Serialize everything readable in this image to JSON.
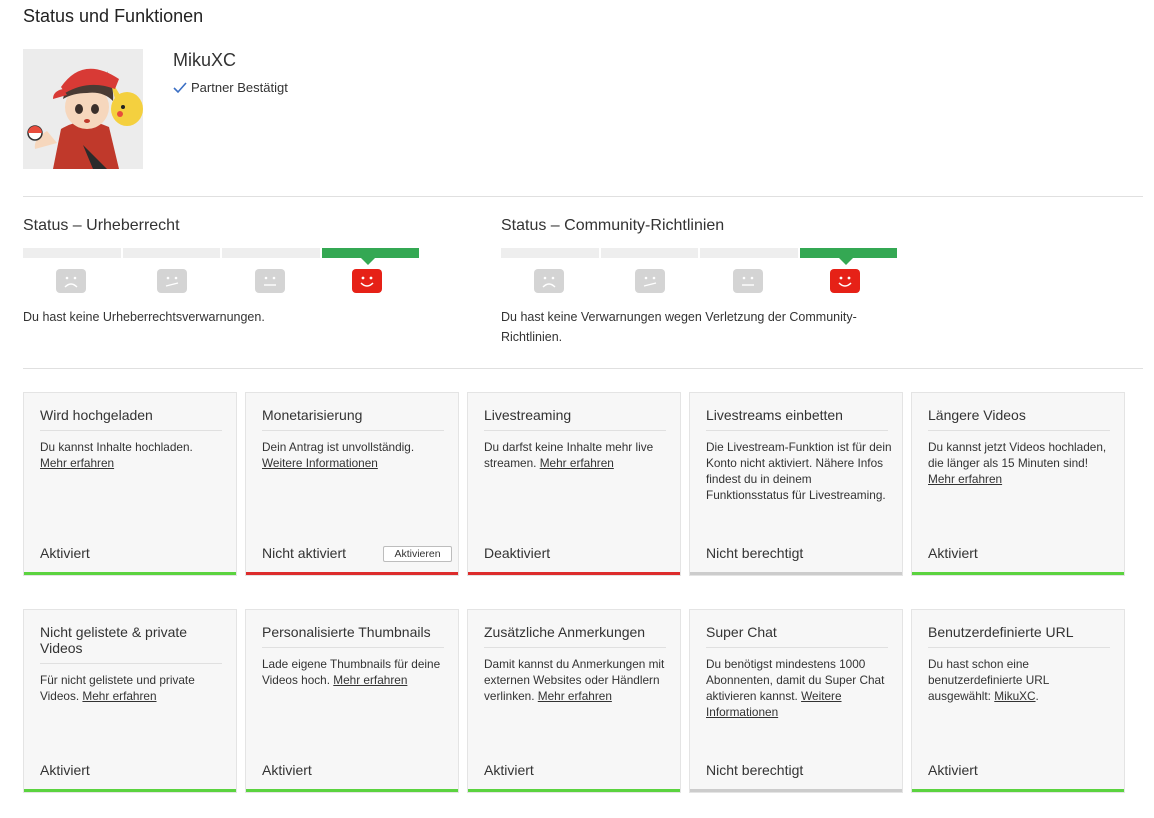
{
  "page": {
    "title": "Status und Funktionen"
  },
  "channel": {
    "name": "MikuXC",
    "partner_label": "Partner Bestätigt"
  },
  "copyright": {
    "title": "Status – Urheberrecht",
    "text": "Du hast keine Urheberrechtsverwarnungen."
  },
  "community": {
    "title": "Status – Community-Richtlinien",
    "text": "Du hast keine Verwarnungen wegen Verletzung der Community-Richtlinien."
  },
  "colors": {
    "enabled": "#5bd33f",
    "disabled": "#dd2c2c",
    "ineligible": "#cccccc",
    "active_segment": "#34a853",
    "active_face": "#e62117"
  },
  "cards": [
    {
      "title": "Wird hochgeladen",
      "desc": "Du kannst Inhalte hochladen.",
      "link": "Mehr erfahren",
      "status": "Aktiviert",
      "state": "enabled"
    },
    {
      "title": "Monetarisierung",
      "desc": "Dein Antrag ist unvollständig.",
      "link": "Weitere Informationen",
      "status": "Nicht aktiviert",
      "state": "disabled",
      "button": "Aktivieren"
    },
    {
      "title": "Livestreaming",
      "desc": "Du darfst keine Inhalte mehr live streamen.",
      "link": "Mehr erfahren",
      "status": "Deaktiviert",
      "state": "disabled"
    },
    {
      "title": "Livestreams einbetten",
      "desc": "Die Livestream-Funktion ist für dein Konto nicht aktiviert. Nähere Infos findest du in deinem Funktionsstatus für Livestreaming.",
      "link": "",
      "status": "Nicht berechtigt",
      "state": "ineligible"
    },
    {
      "title": "Längere Videos",
      "desc": "Du kannst jetzt Videos hochladen, die länger als 15 Minuten sind!",
      "link": "Mehr erfahren",
      "status": "Aktiviert",
      "state": "enabled"
    },
    {
      "title": "Nicht gelistete & private Videos",
      "desc": "Für nicht gelistete und private Videos.",
      "link": "Mehr erfahren",
      "status": "Aktiviert",
      "state": "enabled"
    },
    {
      "title": "Personalisierte Thumbnails",
      "desc": "Lade eigene Thumbnails für deine Videos hoch.",
      "link": "Mehr erfahren",
      "status": "Aktiviert",
      "state": "enabled"
    },
    {
      "title": "Zusätzliche Anmerkungen",
      "desc": "Damit kannst du Anmerkungen mit externen Websites oder Händlern verlinken.",
      "link": "Mehr erfahren",
      "status": "Aktiviert",
      "state": "enabled"
    },
    {
      "title": "Super Chat",
      "desc": "Du benötigst mindestens 1000 Abonnenten, damit du Super Chat aktivieren kannst.",
      "link": "Weitere Informationen",
      "status": "Nicht berechtigt",
      "state": "ineligible"
    },
    {
      "title": "Benutzerdefinierte URL",
      "desc": "Du hast schon eine benutzerdefinierte URL ausgewählt:",
      "link": "MikuXC",
      "after_link": ".",
      "status": "Aktiviert",
      "state": "enabled"
    }
  ]
}
